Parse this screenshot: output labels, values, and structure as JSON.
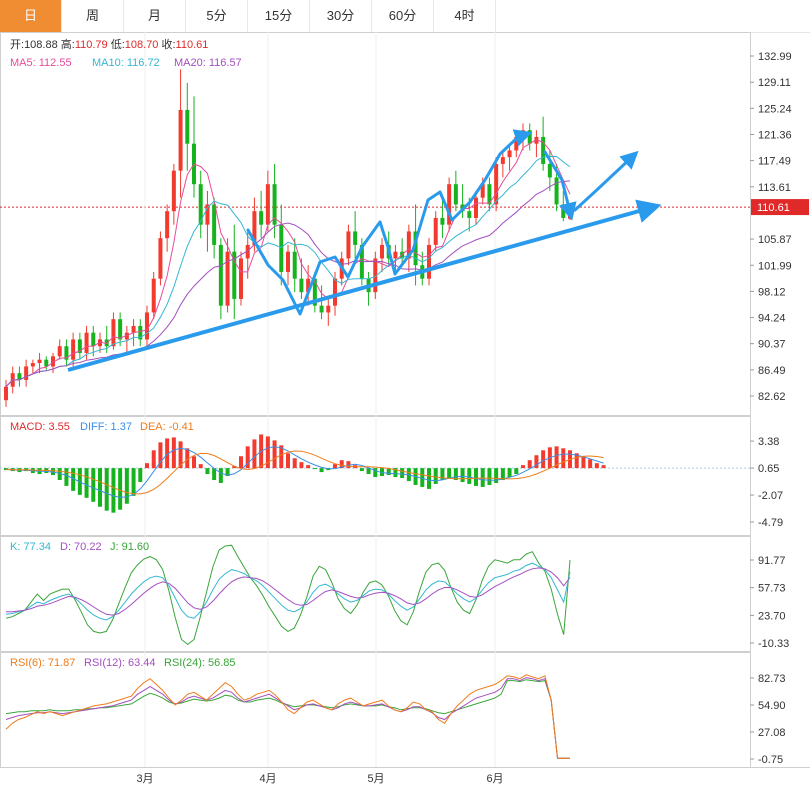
{
  "tabs": [
    {
      "label": "日",
      "active": true
    },
    {
      "label": "周",
      "active": false
    },
    {
      "label": "月",
      "active": false
    },
    {
      "label": "5分",
      "active": false
    },
    {
      "label": "15分",
      "active": false
    },
    {
      "label": "30分",
      "active": false
    },
    {
      "label": "60分",
      "active": false
    },
    {
      "label": "4时",
      "active": false
    }
  ],
  "ohlc_legend": {
    "open_label": "开:",
    "open": "108.88",
    "high_label": "高:",
    "high": "110.79",
    "low_label": "低:",
    "low": "108.70",
    "close_label": "收:",
    "close": "110.61"
  },
  "ma_legend": [
    {
      "label": "MA5: 112.55",
      "color": "#e74c9a"
    },
    {
      "label": "MA10: 116.72",
      "color": "#35b7d1"
    },
    {
      "label": "MA20: 116.57",
      "color": "#a44fc0"
    }
  ],
  "macd_legend": [
    {
      "label": "MACD: 3.55",
      "color": "#e02a2a"
    },
    {
      "label": "DIFF: 1.37",
      "color": "#3a8ee6"
    },
    {
      "label": "DEA: -0.41",
      "color": "#f07c1a"
    }
  ],
  "kdj_legend": [
    {
      "label": "K: 77.34",
      "color": "#35b7d1"
    },
    {
      "label": "D: 70.22",
      "color": "#a44fc0"
    },
    {
      "label": "J: 91.60",
      "color": "#3aa53a"
    }
  ],
  "rsi_legend": [
    {
      "label": "RSI(6): 71.87",
      "color": "#f07c1a"
    },
    {
      "label": "RSI(12): 63.44",
      "color": "#a44fc0"
    },
    {
      "label": "RSI(24): 56.85",
      "color": "#3aa53a"
    }
  ],
  "price_axis": [
    "132.99",
    "129.11",
    "125.24",
    "121.36",
    "117.49",
    "113.61",
    "105.87",
    "101.99",
    "98.12",
    "94.24",
    "90.37",
    "86.49",
    "82.62"
  ],
  "current_price": "110.61",
  "macd_axis": [
    "3.38",
    "0.65",
    "-2.07",
    "-4.79"
  ],
  "kdj_axis": [
    "91.77",
    "57.73",
    "23.70",
    "-10.33"
  ],
  "rsi_axis": [
    "82.73",
    "54.90",
    "27.08",
    "-0.75"
  ],
  "x_axis": [
    "3月",
    "4月",
    "5月",
    "6月"
  ],
  "colors": {
    "up": "#f23a2e",
    "down": "#16b31e",
    "trend": "#2a9bec",
    "price_line": "#e02a2a",
    "tab_active": "#f08c32"
  },
  "chart_data": {
    "type": "candlestick",
    "price_range": [
      82.62,
      132.99
    ],
    "x_labels": [
      "3月",
      "4月",
      "5月",
      "6月"
    ],
    "candles": [
      {
        "o": 82,
        "h": 85,
        "l": 81,
        "c": 84
      },
      {
        "o": 84,
        "h": 87,
        "l": 83,
        "c": 86
      },
      {
        "o": 86,
        "h": 87,
        "l": 84,
        "c": 85
      },
      {
        "o": 85,
        "h": 88,
        "l": 84,
        "c": 87
      },
      {
        "o": 87,
        "h": 88,
        "l": 86,
        "c": 87.5
      },
      {
        "o": 87.5,
        "h": 89,
        "l": 86,
        "c": 88
      },
      {
        "o": 88,
        "h": 88.5,
        "l": 86.5,
        "c": 87
      },
      {
        "o": 87,
        "h": 89,
        "l": 86,
        "c": 88.5
      },
      {
        "o": 88.5,
        "h": 91,
        "l": 88,
        "c": 90
      },
      {
        "o": 90,
        "h": 91,
        "l": 87,
        "c": 88
      },
      {
        "o": 88,
        "h": 92,
        "l": 87,
        "c": 91
      },
      {
        "o": 91,
        "h": 92,
        "l": 88,
        "c": 89
      },
      {
        "o": 89,
        "h": 93,
        "l": 88,
        "c": 92
      },
      {
        "o": 92,
        "h": 93,
        "l": 88.5,
        "c": 90
      },
      {
        "o": 90,
        "h": 92,
        "l": 89,
        "c": 91
      },
      {
        "o": 91,
        "h": 93,
        "l": 89,
        "c": 90
      },
      {
        "o": 90,
        "h": 95,
        "l": 89.5,
        "c": 94
      },
      {
        "o": 94,
        "h": 95,
        "l": 90,
        "c": 91
      },
      {
        "o": 91,
        "h": 93,
        "l": 89,
        "c": 92
      },
      {
        "o": 92,
        "h": 94,
        "l": 90,
        "c": 93
      },
      {
        "o": 93,
        "h": 94,
        "l": 90,
        "c": 91
      },
      {
        "o": 91,
        "h": 96,
        "l": 90,
        "c": 95
      },
      {
        "o": 95,
        "h": 101,
        "l": 94,
        "c": 100
      },
      {
        "o": 100,
        "h": 107,
        "l": 99,
        "c": 106
      },
      {
        "o": 106,
        "h": 111,
        "l": 104,
        "c": 110
      },
      {
        "o": 110,
        "h": 117,
        "l": 108,
        "c": 116
      },
      {
        "o": 116,
        "h": 131,
        "l": 112,
        "c": 125
      },
      {
        "o": 125,
        "h": 129,
        "l": 116,
        "c": 120
      },
      {
        "o": 120,
        "h": 127,
        "l": 112,
        "c": 114
      },
      {
        "o": 114,
        "h": 116,
        "l": 106,
        "c": 108
      },
      {
        "o": 108,
        "h": 113,
        "l": 104,
        "c": 111
      },
      {
        "o": 111,
        "h": 112,
        "l": 103,
        "c": 105
      },
      {
        "o": 105,
        "h": 106,
        "l": 94,
        "c": 96
      },
      {
        "o": 96,
        "h": 106,
        "l": 95,
        "c": 104
      },
      {
        "o": 104,
        "h": 108,
        "l": 94,
        "c": 97
      },
      {
        "o": 97,
        "h": 104,
        "l": 96,
        "c": 103
      },
      {
        "o": 103,
        "h": 107,
        "l": 100,
        "c": 105
      },
      {
        "o": 105,
        "h": 112,
        "l": 104,
        "c": 110
      },
      {
        "o": 110,
        "h": 113,
        "l": 106,
        "c": 108
      },
      {
        "o": 108,
        "h": 116,
        "l": 107,
        "c": 114
      },
      {
        "o": 114,
        "h": 117,
        "l": 106,
        "c": 108
      },
      {
        "o": 108,
        "h": 111,
        "l": 99,
        "c": 101
      },
      {
        "o": 101,
        "h": 105,
        "l": 99,
        "c": 104
      },
      {
        "o": 104,
        "h": 106,
        "l": 98,
        "c": 100
      },
      {
        "o": 100,
        "h": 103,
        "l": 97,
        "c": 98
      },
      {
        "o": 98,
        "h": 102,
        "l": 96,
        "c": 100
      },
      {
        "o": 100,
        "h": 101,
        "l": 95,
        "c": 96
      },
      {
        "o": 96,
        "h": 99,
        "l": 94,
        "c": 95
      },
      {
        "o": 95,
        "h": 97,
        "l": 93,
        "c": 96
      },
      {
        "o": 96,
        "h": 101,
        "l": 94.5,
        "c": 100
      },
      {
        "o": 100,
        "h": 104,
        "l": 99,
        "c": 103
      },
      {
        "o": 103,
        "h": 108,
        "l": 102,
        "c": 107
      },
      {
        "o": 107,
        "h": 110,
        "l": 103,
        "c": 105
      },
      {
        "o": 105,
        "h": 106,
        "l": 99,
        "c": 100
      },
      {
        "o": 100,
        "h": 101,
        "l": 96,
        "c": 98
      },
      {
        "o": 98,
        "h": 104,
        "l": 97,
        "c": 103
      },
      {
        "o": 103,
        "h": 106,
        "l": 101,
        "c": 105
      },
      {
        "o": 105,
        "h": 107,
        "l": 102,
        "c": 103
      },
      {
        "o": 103,
        "h": 105,
        "l": 101,
        "c": 104
      },
      {
        "o": 104,
        "h": 106,
        "l": 102,
        "c": 103
      },
      {
        "o": 103,
        "h": 108,
        "l": 101,
        "c": 107
      },
      {
        "o": 107,
        "h": 111,
        "l": 99,
        "c": 102
      },
      {
        "o": 102,
        "h": 104,
        "l": 99,
        "c": 100
      },
      {
        "o": 100,
        "h": 106,
        "l": 99,
        "c": 105
      },
      {
        "o": 105,
        "h": 110,
        "l": 104,
        "c": 109
      },
      {
        "o": 109,
        "h": 112,
        "l": 106,
        "c": 108
      },
      {
        "o": 108,
        "h": 115,
        "l": 107,
        "c": 114
      },
      {
        "o": 114,
        "h": 116,
        "l": 110,
        "c": 111
      },
      {
        "o": 111,
        "h": 114,
        "l": 109,
        "c": 110
      },
      {
        "o": 110,
        "h": 112,
        "l": 107,
        "c": 109
      },
      {
        "o": 109,
        "h": 113,
        "l": 108,
        "c": 112
      },
      {
        "o": 112,
        "h": 115,
        "l": 111,
        "c": 114
      },
      {
        "o": 114,
        "h": 115,
        "l": 110,
        "c": 111
      },
      {
        "o": 111,
        "h": 118,
        "l": 110,
        "c": 117
      },
      {
        "o": 117,
        "h": 119,
        "l": 115,
        "c": 118
      },
      {
        "o": 118,
        "h": 120,
        "l": 116,
        "c": 119
      },
      {
        "o": 119,
        "h": 122,
        "l": 118,
        "c": 121
      },
      {
        "o": 121,
        "h": 123,
        "l": 119,
        "c": 122
      },
      {
        "o": 122,
        "h": 123,
        "l": 119,
        "c": 120
      },
      {
        "o": 120,
        "h": 122,
        "l": 118,
        "c": 121
      },
      {
        "o": 121,
        "h": 124,
        "l": 116,
        "c": 117
      },
      {
        "o": 117,
        "h": 119,
        "l": 113,
        "c": 115
      },
      {
        "o": 115,
        "h": 117,
        "l": 110,
        "c": 111
      },
      {
        "o": 111,
        "h": 113,
        "l": 108.5,
        "c": 109
      },
      {
        "o": 108.88,
        "h": 110.79,
        "l": 108.7,
        "c": 110.61
      }
    ],
    "macd": [
      -0.2,
      -0.3,
      -0.4,
      -0.3,
      -0.5,
      -0.6,
      -0.5,
      -0.7,
      -1.2,
      -1.8,
      -2.3,
      -2.7,
      -3.0,
      -3.4,
      -3.9,
      -4.3,
      -4.5,
      -4.2,
      -3.6,
      -2.8,
      -1.4,
      0.5,
      1.8,
      2.6,
      3.0,
      3.1,
      2.7,
      2.0,
      1.2,
      0.4,
      -0.6,
      -1.2,
      -1.5,
      -0.8,
      0.2,
      1.2,
      2.2,
      2.9,
      3.4,
      3.2,
      2.8,
      2.3,
      1.5,
      1.0,
      0.6,
      0.3,
      -0.1,
      -0.4,
      -0.2,
      0.4,
      0.8,
      0.7,
      0.3,
      -0.3,
      -0.6,
      -0.9,
      -0.8,
      -0.7,
      -0.9,
      -1.0,
      -1.3,
      -1.7,
      -1.9,
      -2.1,
      -1.6,
      -1.2,
      -1.0,
      -1.2,
      -1.4,
      -1.6,
      -1.8,
      -1.9,
      -1.7,
      -1.5,
      -1.2,
      -0.9,
      -0.6,
      0.3,
      0.8,
      1.3,
      1.8,
      2.1,
      2.2,
      2.0,
      1.8,
      1.5,
      1.2,
      0.9,
      0.5,
      0.3
    ],
    "k": [
      25,
      26,
      28,
      30,
      35,
      40,
      38,
      42,
      45,
      48,
      50,
      45,
      38,
      30,
      24,
      20,
      18,
      22,
      30,
      40,
      50,
      58,
      65,
      70,
      72,
      70,
      60,
      45,
      30,
      22,
      20,
      28,
      40,
      55,
      68,
      75,
      80,
      78,
      75,
      70,
      66,
      60,
      52,
      44,
      36,
      30,
      28,
      32,
      40,
      52,
      60,
      62,
      58,
      50,
      44,
      40,
      42,
      48,
      54,
      56,
      55,
      50,
      42,
      35,
      30,
      34,
      44,
      55,
      62,
      66,
      65,
      58,
      50,
      44,
      40,
      45,
      55,
      64,
      70,
      72,
      74,
      78,
      80,
      85,
      88,
      84,
      80,
      70,
      55,
      40,
      77.34
    ],
    "d": [
      28,
      28,
      29,
      30,
      32,
      35,
      36,
      38,
      41,
      44,
      47,
      46,
      43,
      39,
      34,
      29,
      25,
      24,
      26,
      31,
      37,
      44,
      51,
      57,
      62,
      65,
      63,
      57,
      48,
      39,
      33,
      31,
      34,
      41,
      50,
      58,
      65,
      69,
      71,
      70,
      69,
      66,
      61,
      55,
      49,
      43,
      38,
      36,
      37,
      42,
      48,
      53,
      55,
      53,
      50,
      47,
      45,
      46,
      49,
      51,
      52,
      51,
      48,
      44,
      39,
      37,
      39,
      44,
      50,
      55,
      58,
      58,
      55,
      51,
      47,
      46,
      49,
      54,
      59,
      63,
      67,
      71,
      74,
      78,
      81,
      82,
      81,
      77,
      70,
      60,
      70.22
    ],
    "j": [
      20,
      22,
      26,
      30,
      40,
      50,
      42,
      50,
      53,
      56,
      56,
      43,
      28,
      12,
      4,
      2,
      4,
      18,
      38,
      58,
      76,
      86,
      93,
      96,
      92,
      80,
      54,
      21,
      -6,
      -12,
      -6,
      22,
      52,
      83,
      104,
      109,
      110,
      96,
      83,
      70,
      60,
      48,
      34,
      22,
      10,
      4,
      8,
      24,
      46,
      72,
      84,
      80,
      64,
      44,
      32,
      26,
      36,
      52,
      64,
      66,
      61,
      48,
      30,
      17,
      12,
      28,
      54,
      77,
      86,
      88,
      79,
      58,
      40,
      30,
      26,
      43,
      67,
      84,
      92,
      90,
      88,
      92,
      92,
      99,
      102,
      88,
      78,
      56,
      25,
      0,
      91.6
    ],
    "rsi6": [
      30,
      36,
      40,
      42,
      45,
      48,
      46,
      48,
      46,
      44,
      46,
      48,
      50,
      52,
      54,
      55,
      56,
      58,
      60,
      62,
      64,
      72,
      78,
      82,
      76,
      70,
      62,
      55,
      60,
      66,
      68,
      64,
      60,
      66,
      72,
      78,
      74,
      66,
      60,
      62,
      66,
      68,
      70,
      65,
      58,
      50,
      46,
      52,
      58,
      60,
      56,
      52,
      50,
      56,
      60,
      62,
      58,
      54,
      56,
      58,
      60,
      54,
      50,
      48,
      52,
      58,
      56,
      50,
      48,
      40,
      36,
      46,
      54,
      60,
      66,
      70,
      72,
      74,
      76,
      80,
      85,
      84,
      82,
      86,
      84,
      82,
      85,
      60,
      0,
      0,
      0
    ],
    "rsi12": [
      40,
      42,
      44,
      45,
      46,
      47,
      47,
      48,
      47,
      46,
      47,
      48,
      49,
      50,
      51,
      52,
      53,
      54,
      56,
      58,
      60,
      66,
      70,
      74,
      70,
      66,
      60,
      56,
      58,
      62,
      64,
      62,
      60,
      62,
      66,
      70,
      68,
      62,
      58,
      60,
      62,
      64,
      66,
      62,
      58,
      54,
      50,
      52,
      55,
      56,
      54,
      52,
      50,
      52,
      56,
      58,
      56,
      54,
      54,
      55,
      56,
      53,
      50,
      48,
      50,
      53,
      53,
      50,
      47,
      42,
      40,
      46,
      50,
      54,
      58,
      62,
      64,
      66,
      68,
      72,
      82,
      82,
      80,
      83,
      82,
      80,
      82,
      60,
      0,
      0,
      0
    ],
    "rsi24": [
      46,
      47,
      48,
      48,
      49,
      49,
      49,
      50,
      49,
      49,
      49,
      50,
      50,
      51,
      51,
      52,
      52,
      53,
      54,
      55,
      56,
      60,
      64,
      67,
      65,
      62,
      58,
      56,
      57,
      59,
      61,
      60,
      59,
      60,
      62,
      65,
      64,
      60,
      58,
      58,
      60,
      61,
      62,
      60,
      57,
      55,
      53,
      54,
      55,
      55,
      54,
      53,
      52,
      53,
      55,
      56,
      55,
      54,
      54,
      54,
      55,
      53,
      52,
      50,
      51,
      52,
      52,
      51,
      49,
      47,
      46,
      48,
      50,
      52,
      54,
      56,
      58,
      60,
      62,
      66,
      80,
      80,
      79,
      81,
      80,
      79,
      80,
      60,
      0,
      0,
      0
    ]
  }
}
